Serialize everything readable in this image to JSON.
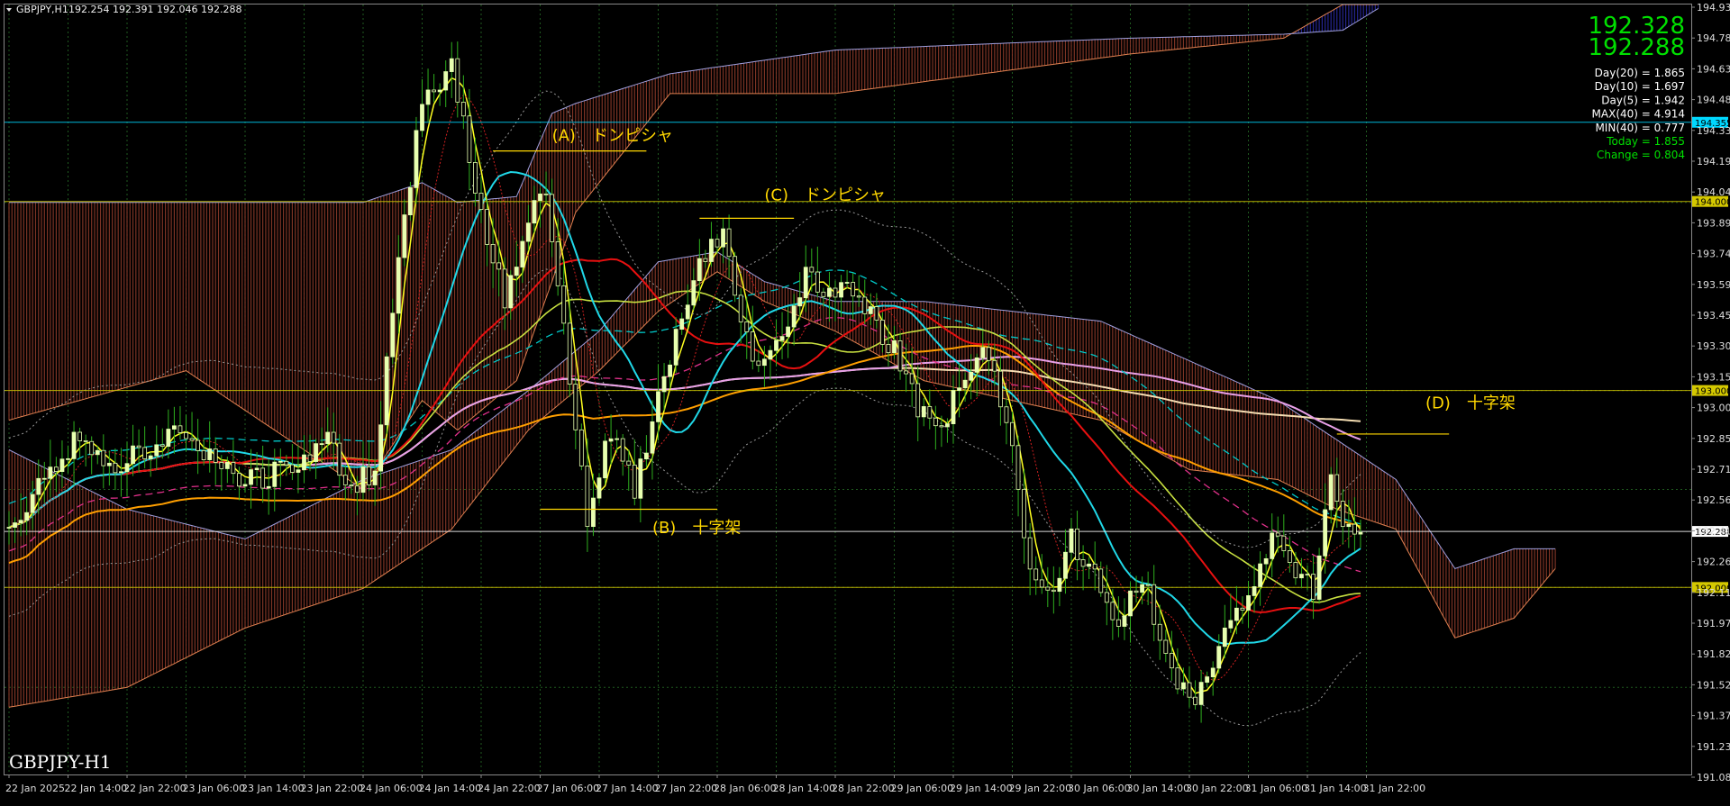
{
  "header": {
    "symbol": "GBPJPY,H1",
    "ohlc": "192.254 192.391 192.046 192.288",
    "menu_icon": "triangle-down-icon"
  },
  "bottom_label": "GBPJPY-H1",
  "big_prices": [
    "192.328",
    "192.288"
  ],
  "stats": [
    {
      "text": "Day(20) = 1.865",
      "color": "#ffffff"
    },
    {
      "text": "Day(10) = 1.697",
      "color": "#ffffff"
    },
    {
      "text": "Day(5) = 1.942",
      "color": "#ffffff"
    },
    {
      "text": "MAX(40) = 4.914",
      "color": "#ffffff"
    },
    {
      "text": "MIN(40) = 0.777",
      "color": "#ffffff"
    },
    {
      "text": "Today = 1.855",
      "color": "#00e000"
    },
    {
      "text": "Change = 0.804",
      "color": "#00e000"
    }
  ],
  "colors": {
    "background": "#000000",
    "candle": "#e8ffb0",
    "wick": "#2eaf1e",
    "grid": "#1f5a1f",
    "cloud_bear": "#8b3a2a",
    "cloud_bull": "#2a2aa0",
    "annotation": "#ffd700"
  },
  "annotations": [
    {
      "label": "(A)　ドンピシャ",
      "t": 92,
      "price": 194.26,
      "line_from": 82,
      "line_to": 108,
      "line_price": 194.21
    },
    {
      "label": "(C)　ドンピシャ",
      "t": 128,
      "price": 193.96,
      "line_from": 117,
      "line_to": 133,
      "line_price": 193.87
    },
    {
      "label": "(B)　十字架",
      "t": 109,
      "price": 192.28,
      "line_from": 90,
      "line_to": 120,
      "line_price": 192.4
    },
    {
      "label": "(D)　十字架",
      "t": 240,
      "price": 192.91,
      "line_from": 225,
      "line_to": 244,
      "line_price": 192.78
    }
  ],
  "chart_data": {
    "type": "candlestick",
    "title": "GBPJPY,H1",
    "y_axis_position": "right",
    "ylim": [
      191.06,
      194.95
    ],
    "y_ticks": [
      "194.930",
      "194.780",
      "194.635",
      "194.485",
      "194.335",
      "194.190",
      "194.040",
      "193.895",
      "193.745",
      "193.595",
      "193.450",
      "193.300",
      "193.150",
      "193.000",
      "192.855",
      "192.710",
      "192.560",
      "192.415",
      "192.265",
      "192.115",
      "191.970",
      "191.820",
      "191.525",
      "191.375",
      "191.230",
      "191.080"
    ],
    "price_labels": [
      {
        "value": "194.355",
        "price": 194.355,
        "color": "#00d8ff"
      },
      {
        "value": "194.000",
        "price": 193.955,
        "color": "#d4c800"
      },
      {
        "value": "193.000",
        "price": 193.0,
        "color": "#d4c800"
      },
      {
        "value": "192.288",
        "price": 192.288,
        "color": "#ffffff"
      },
      {
        "value": "192.000",
        "price": 192.005,
        "color": "#d4c800"
      }
    ],
    "time_labels": [
      {
        "t": 0,
        "label": "22 Jan 2025"
      },
      {
        "t": 10,
        "label": "22 Jan 14:00"
      },
      {
        "t": 20,
        "label": "22 Jan 22:00"
      },
      {
        "t": 30,
        "label": "23 Jan 06:00"
      },
      {
        "t": 40,
        "label": "23 Jan 14:00"
      },
      {
        "t": 50,
        "label": "23 Jan 22:00"
      },
      {
        "t": 60,
        "label": "24 Jan 06:00"
      },
      {
        "t": 70,
        "label": "24 Jan 14:00"
      },
      {
        "t": 80,
        "label": "24 Jan 22:00"
      },
      {
        "t": 90,
        "label": "27 Jan 06:00"
      },
      {
        "t": 100,
        "label": "27 Jan 14:00"
      },
      {
        "t": 110,
        "label": "27 Jan 22:00"
      },
      {
        "t": 120,
        "label": "28 Jan 06:00"
      },
      {
        "t": 130,
        "label": "28 Jan 14:00"
      },
      {
        "t": 140,
        "label": "28 Jan 22:00"
      },
      {
        "t": 150,
        "label": "29 Jan 06:00"
      },
      {
        "t": 160,
        "label": "29 Jan 14:00"
      },
      {
        "t": 170,
        "label": "29 Jan 22:00"
      },
      {
        "t": 180,
        "label": "30 Jan 06:00"
      },
      {
        "t": 190,
        "label": "30 Jan 14:00"
      },
      {
        "t": 200,
        "label": "30 Jan 22:00"
      },
      {
        "t": 210,
        "label": "31 Jan 06:00"
      },
      {
        "t": 220,
        "label": "31 Jan 14:00"
      },
      {
        "t": 230,
        "label": "31 Jan 22:00"
      }
    ],
    "close_anchors": [
      [
        0,
        192.25
      ],
      [
        6,
        192.55
      ],
      [
        12,
        192.78
      ],
      [
        18,
        192.62
      ],
      [
        24,
        192.7
      ],
      [
        30,
        192.8
      ],
      [
        36,
        192.6
      ],
      [
        42,
        192.55
      ],
      [
        48,
        192.62
      ],
      [
        54,
        192.74
      ],
      [
        58,
        192.52
      ],
      [
        62,
        192.6
      ],
      [
        66,
        193.7
      ],
      [
        70,
        194.45
      ],
      [
        75,
        194.62
      ],
      [
        80,
        193.9
      ],
      [
        84,
        193.45
      ],
      [
        88,
        193.9
      ],
      [
        91,
        194.05
      ],
      [
        95,
        193.05
      ],
      [
        98,
        192.35
      ],
      [
        102,
        192.8
      ],
      [
        106,
        192.5
      ],
      [
        110,
        192.95
      ],
      [
        114,
        193.4
      ],
      [
        118,
        193.7
      ],
      [
        121,
        193.82
      ],
      [
        124,
        193.4
      ],
      [
        127,
        193.1
      ],
      [
        131,
        193.3
      ],
      [
        135,
        193.6
      ],
      [
        138,
        193.48
      ],
      [
        142,
        193.55
      ],
      [
        146,
        193.38
      ],
      [
        150,
        193.2
      ],
      [
        154,
        192.9
      ],
      [
        158,
        192.8
      ],
      [
        162,
        193.1
      ],
      [
        166,
        193.2
      ],
      [
        170,
        192.7
      ],
      [
        173,
        192.05
      ],
      [
        176,
        191.95
      ],
      [
        180,
        192.25
      ],
      [
        184,
        192.05
      ],
      [
        188,
        191.85
      ],
      [
        192,
        192.05
      ],
      [
        196,
        191.7
      ],
      [
        200,
        191.4
      ],
      [
        203,
        191.55
      ],
      [
        206,
        191.8
      ],
      [
        210,
        191.95
      ],
      [
        214,
        192.25
      ],
      [
        218,
        192.1
      ],
      [
        221,
        191.98
      ],
      [
        224,
        192.55
      ],
      [
        226,
        192.3
      ],
      [
        229,
        192.288
      ]
    ],
    "seed": 20250131,
    "cloud_edges": [
      [
        0,
        192.85,
        193.95
      ],
      [
        30,
        193.1,
        193.95
      ],
      [
        60,
        192.5,
        193.95
      ],
      [
        70,
        192.95,
        194.05
      ],
      [
        76,
        192.8,
        193.95
      ],
      [
        86,
        193.05,
        193.98
      ],
      [
        92,
        193.55,
        194.4
      ],
      [
        96,
        193.9,
        194.45
      ],
      [
        112,
        194.5,
        194.6
      ],
      [
        140,
        194.5,
        194.72
      ],
      [
        190,
        194.7,
        194.78
      ],
      [
        216,
        194.78,
        194.8
      ],
      [
        226,
        194.95,
        194.82
      ],
      [
        232,
        194.95,
        194.93
      ]
    ],
    "cloud2_edges": [
      [
        0,
        191.4,
        192.7
      ],
      [
        20,
        191.5,
        192.4
      ],
      [
        40,
        191.8,
        192.25
      ],
      [
        60,
        192.0,
        192.55
      ],
      [
        75,
        192.3,
        192.7
      ],
      [
        88,
        192.8,
        193.0
      ],
      [
        100,
        193.1,
        193.3
      ],
      [
        110,
        193.4,
        193.65
      ],
      [
        120,
        193.6,
        193.7
      ],
      [
        128,
        193.45,
        193.55
      ],
      [
        140,
        193.3,
        193.45
      ],
      [
        155,
        193.05,
        193.45
      ],
      [
        170,
        192.95,
        193.4
      ],
      [
        185,
        192.85,
        193.35
      ],
      [
        200,
        192.6,
        193.15
      ],
      [
        215,
        192.55,
        192.95
      ],
      [
        225,
        192.4,
        192.75
      ],
      [
        235,
        192.3,
        192.55
      ],
      [
        245,
        191.75,
        192.1
      ],
      [
        255,
        191.85,
        192.2
      ],
      [
        262,
        192.1,
        192.2
      ]
    ]
  }
}
